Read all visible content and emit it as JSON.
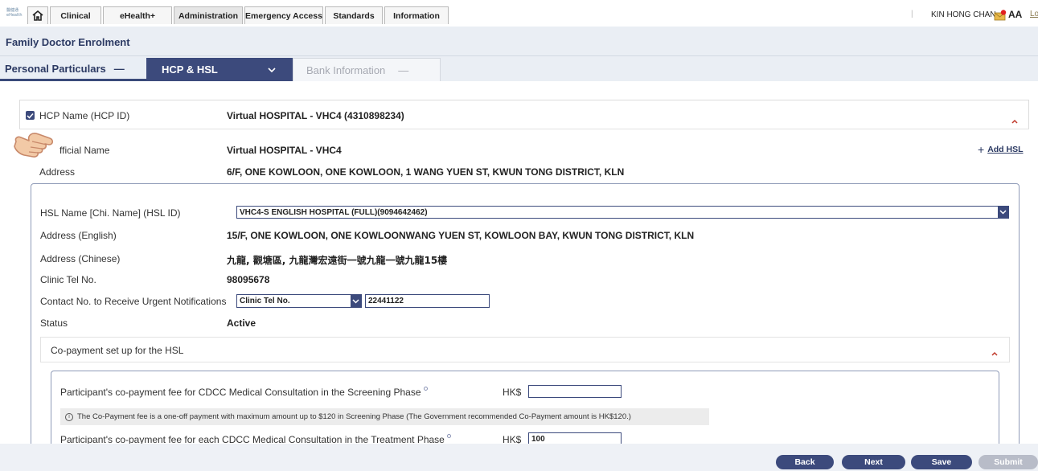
{
  "topbar": {
    "logo_text": "醫健通 eHealth",
    "tabs": [
      "Clinical",
      "eHealth+",
      "Administration",
      "Emergency Access",
      "Standards",
      "Information"
    ],
    "separator": "|",
    "user_name": "KIN HONG CHAN",
    "font_size_label": "AA",
    "logout_label": "Lo"
  },
  "page": {
    "title": "Family Doctor Enrolment"
  },
  "steps": {
    "personal": "Personal Particulars",
    "personal_mark": "—",
    "hcp": "HCP & HSL",
    "bank": "Bank Information",
    "bank_mark": "—"
  },
  "hcp": {
    "name_label": "HCP Name (HCP ID)",
    "name_value": "Virtual HOSPITAL - VHC4 (4310898234)",
    "official_label": "fficial Name",
    "official_value": "Virtual HOSPITAL - VHC4",
    "address_label": "Address",
    "address_value": "6/F, ONE KOWLOON, ONE KOWLOON, 1 WANG YUEN ST, KWUN TONG DISTRICT, KLN",
    "add_hsl": "Add HSL"
  },
  "hsl": {
    "name_label": "HSL Name [Chi. Name] (HSL ID)",
    "name_selected": "VHC4-S ENGLISH HOSPITAL (FULL)(9094642462)",
    "addr_en_label": "Address (English)",
    "addr_en_value": "15/F, ONE KOWLOON, ONE KOWLOONWANG YUEN ST, KOWLOON BAY, KWUN TONG DISTRICT, KLN",
    "addr_zh_label": "Address (Chinese)",
    "addr_zh_value": "九龍, 觀塘區, 九龍灣宏遠街一號九龍一號九龍15樓",
    "tel_label": "Clinic Tel No.",
    "tel_value": "98095678",
    "contact_label": "Contact No. to Receive Urgent Notifications",
    "contact_type": "Clinic Tel No.",
    "contact_number": "22441122",
    "status_label": "Status",
    "status_value": "Active"
  },
  "copay": {
    "section_title": "Co-payment set up for the HSL",
    "screening_label": "Participant's co-payment fee for CDCC Medical Consultation in the Screening Phase",
    "currency": "HK$",
    "screening_value": "",
    "note": "The Co-Payment fee is a one-off payment with maximum amount up to $120 in Screening Phase (The Government recommended Co-Payment amount is HK$120.)",
    "treatment_label": "Participant's co-payment fee for each CDCC Medical Consultation in the Treatment Phase",
    "treatment_value": "100"
  },
  "actions": {
    "back": "Back",
    "next": "Next",
    "save": "Save",
    "submit": "Submit"
  },
  "colors": {
    "primary": "#3c4a7c",
    "header_band": "#eaeef4",
    "notify_dot": "#e02020"
  }
}
